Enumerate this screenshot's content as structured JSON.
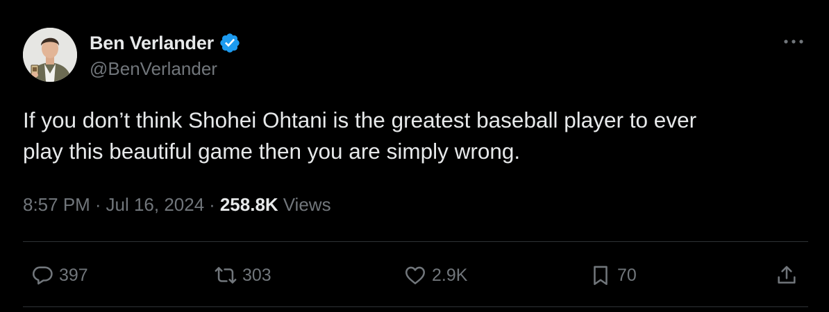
{
  "author": {
    "display_name": "Ben Verlander",
    "handle": "@BenVerlander",
    "verified": true,
    "verified_color": "#1d9bf0"
  },
  "tweet": {
    "text": "If you don’t think Shohei Ohtani is the greatest baseball player to ever\nplay this beautiful game then you are simply wrong.",
    "time": "8:57 PM",
    "separator": "·",
    "date": "Jul 16, 2024",
    "views_count": "258.8K",
    "views_label": "Views"
  },
  "actions": {
    "replies": "397",
    "reposts": "303",
    "likes": "2.9K",
    "bookmarks": "70"
  },
  "icons": {
    "more": "more-horizontal-icon",
    "reply": "speech-bubble-icon",
    "repost": "repost-arrows-icon",
    "like": "heart-icon",
    "bookmark": "bookmark-icon",
    "share": "share-upload-icon"
  },
  "colors": {
    "background": "#000000",
    "primary_text": "#e7e9ea",
    "secondary_text": "#71767b",
    "divider": "#2f3336",
    "verified": "#1d9bf0"
  }
}
